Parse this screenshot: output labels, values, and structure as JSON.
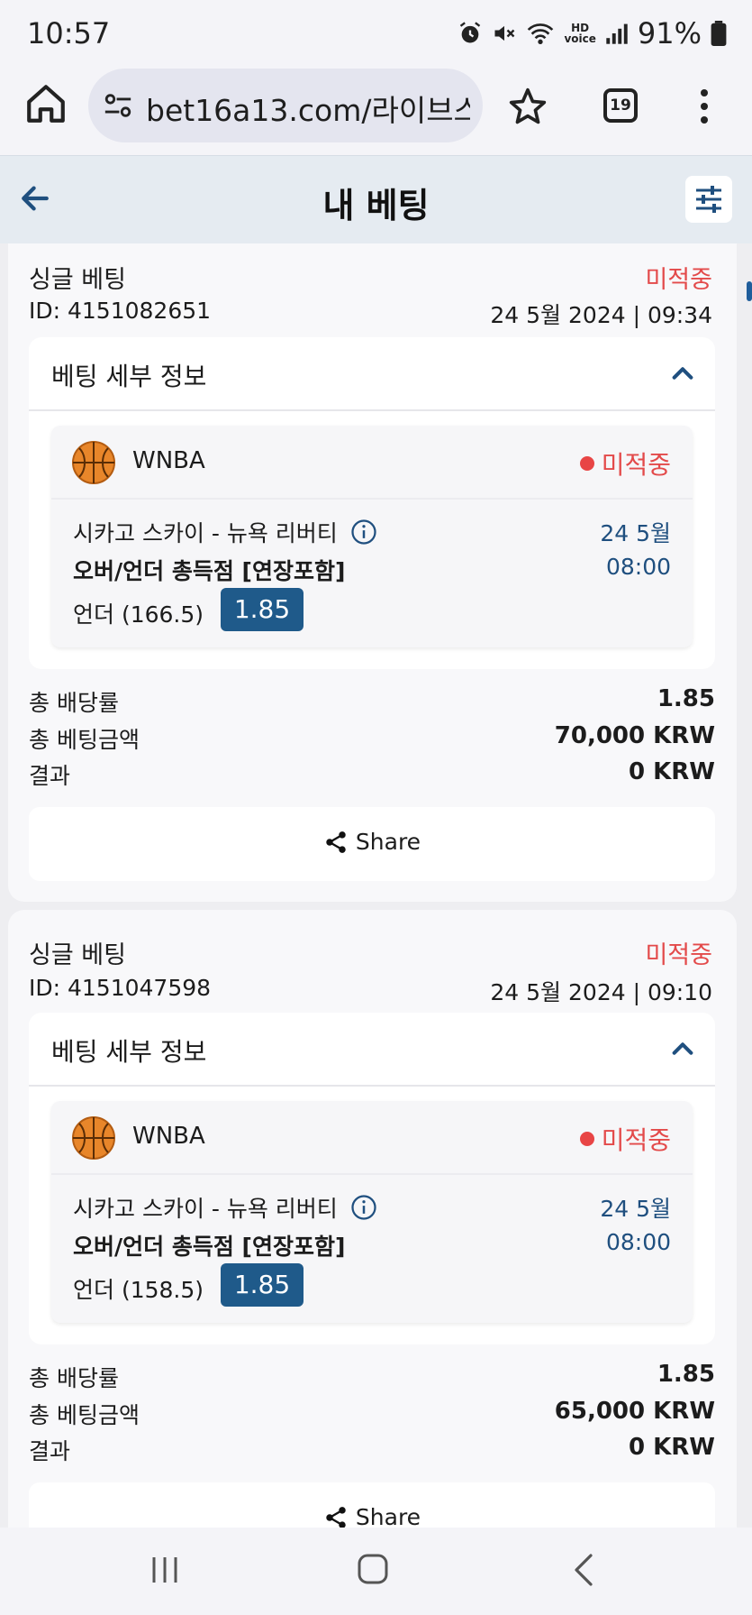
{
  "status_bar": {
    "time": "10:57",
    "battery": "91%",
    "hd_top": "HD",
    "hd_bottom": "voice"
  },
  "browser": {
    "url": "bet16a13.com/라이브스",
    "tab_count": "19"
  },
  "header": {
    "title": "내 베팅"
  },
  "bets": [
    {
      "type": "싱글 베팅",
      "status": "미적중",
      "id": "ID: 4151082651",
      "date": "24 5월 2024 | 09:34",
      "details_title": "베팅 세부 정보",
      "league": "WNBA",
      "selection_status": "미적중",
      "match": "시카고 스카이 - 뉴욕 리버티",
      "match_date": "24 5월",
      "match_time": "08:00",
      "market": "오버/언더 총득점 [연장포함]",
      "pick": "언더 (166.5)",
      "odds": "1.85",
      "total_odds_label": "총 배당률",
      "total_odds": "1.85",
      "stake_label": "총 베팅금액",
      "stake": "70,000 KRW",
      "result_label": "결과",
      "result": "0 KRW",
      "share_label": "Share"
    },
    {
      "type": "싱글 베팅",
      "status": "미적중",
      "id": "ID: 4151047598",
      "date": "24 5월 2024 | 09:10",
      "details_title": "베팅 세부 정보",
      "league": "WNBA",
      "selection_status": "미적중",
      "match": "시카고 스카이 - 뉴욕 리버티",
      "match_date": "24 5월",
      "match_time": "08:00",
      "market": "오버/언더 총득점 [연장포함]",
      "pick": "언더 (158.5)",
      "odds": "1.85",
      "total_odds_label": "총 배당률",
      "total_odds": "1.85",
      "stake_label": "총 베팅금액",
      "stake": "65,000 KRW",
      "result_label": "결과",
      "result": "0 KRW",
      "share_label": "Share"
    }
  ],
  "colors": {
    "accent": "#1f5a8a",
    "lost": "#e34a4a",
    "header_bg": "#e5ebf1"
  }
}
